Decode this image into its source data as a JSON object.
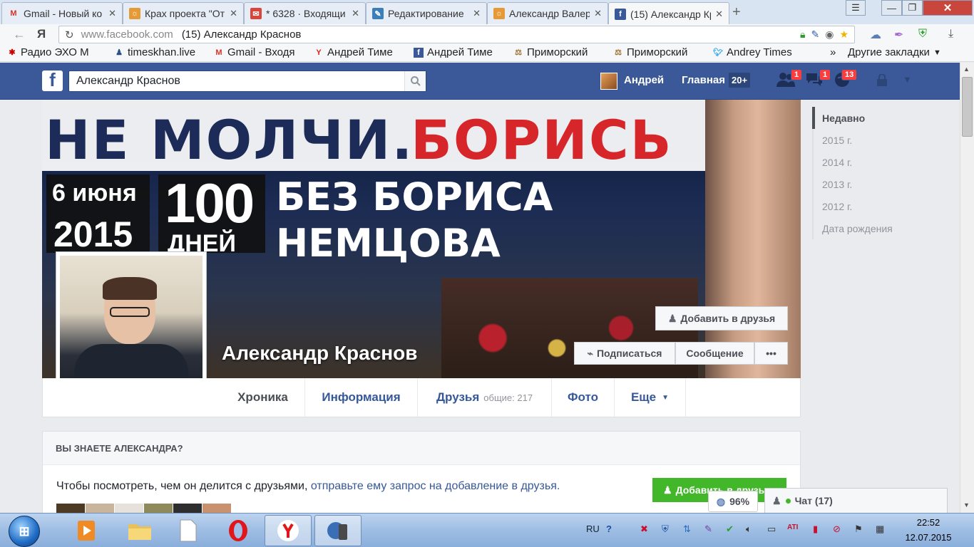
{
  "browser": {
    "tabs": [
      {
        "title": "Gmail - Новый ко",
        "icon": "gmail-icon",
        "color": "#d93025"
      },
      {
        "title": "Крах проекта \"От",
        "icon": "sun-icon",
        "color": "#e69a35"
      },
      {
        "title": "* 6328 · Входящи",
        "icon": "mail-icon",
        "color": "#d9453b"
      },
      {
        "title": "Редактирование",
        "icon": "blog-icon",
        "color": "#3c7fb8"
      },
      {
        "title": "Александр Валер",
        "icon": "sun-icon",
        "color": "#e69a35"
      },
      {
        "title": "(15) Александр Кр",
        "icon": "facebook-icon",
        "color": "#3b5998"
      }
    ],
    "back_glyph": "Я",
    "url_domain": "www.facebook.com",
    "url_title": "(15) Александр Краснов",
    "bookmarks": [
      {
        "label": "Радио ЭХО М",
        "icon": "radio-icon",
        "color": "#c00"
      },
      {
        "label": "timeskhan.live",
        "icon": "user-icon",
        "color": "#2a4f8a"
      },
      {
        "label": "Gmail - Входя",
        "icon": "gmail-icon",
        "color": "#d93025"
      },
      {
        "label": "Андрей Тиме",
        "icon": "yandex-icon",
        "color": "#e02020"
      },
      {
        "label": "Андрей Тиме",
        "icon": "facebook-icon",
        "color": "#3b5998"
      },
      {
        "label": "Приморский",
        "icon": "scales-icon",
        "color": "#a07030"
      },
      {
        "label": "Приморский",
        "icon": "scales-icon",
        "color": "#a07030"
      },
      {
        "label": "Andrey Times",
        "icon": "twitter-icon",
        "color": "#1da1f2"
      }
    ],
    "bookmarks_overflow": "»",
    "other_bookmarks": "Другие закладки"
  },
  "facebook": {
    "search_value": "Александр Краснов",
    "nav_user": "Андрей",
    "nav_home": "Главная",
    "nav_home_count": "20+",
    "badges": {
      "friends": "1",
      "messages": "1",
      "notifications": "13"
    },
    "cover": {
      "line1a": "НЕ МОЛЧИ.",
      "line1b": "БОРИСЬ",
      "date_day": "6 июня",
      "date_year": "2015",
      "days_num": "100",
      "days_word": "ДНЕЙ",
      "without1": "БЕЗ БОРИСА",
      "without2": "НЕМЦОВА"
    },
    "profile_name": "Александр Краснов",
    "actions": {
      "add_friend": "Добавить в друзья",
      "subscribe": "Подписаться",
      "message": "Сообщение",
      "more": "•••"
    },
    "tabs": [
      {
        "label": "Хроника"
      },
      {
        "label": "Информация"
      },
      {
        "label": "Друзья",
        "sub": "общие: 217"
      },
      {
        "label": "Фото"
      },
      {
        "label": "Еще"
      }
    ],
    "scrubber": [
      "Недавно",
      "2015 г.",
      "2014 г.",
      "2013 г.",
      "2012 г.",
      "Дата рождения"
    ],
    "know": {
      "header": "ВЫ ЗНАЕТЕ АЛЕКСАНДРА?",
      "text": "Чтобы посмотреть, чем он делится с друзьями,",
      "link": "отправьте ему запрос на добавление в друзья.",
      "button": "Добавить в друзья"
    },
    "zoom_pill": "96%",
    "chat": "Чат (17)"
  },
  "taskbar": {
    "lang": "RU",
    "time": "22:52",
    "date": "12.07.2015"
  }
}
